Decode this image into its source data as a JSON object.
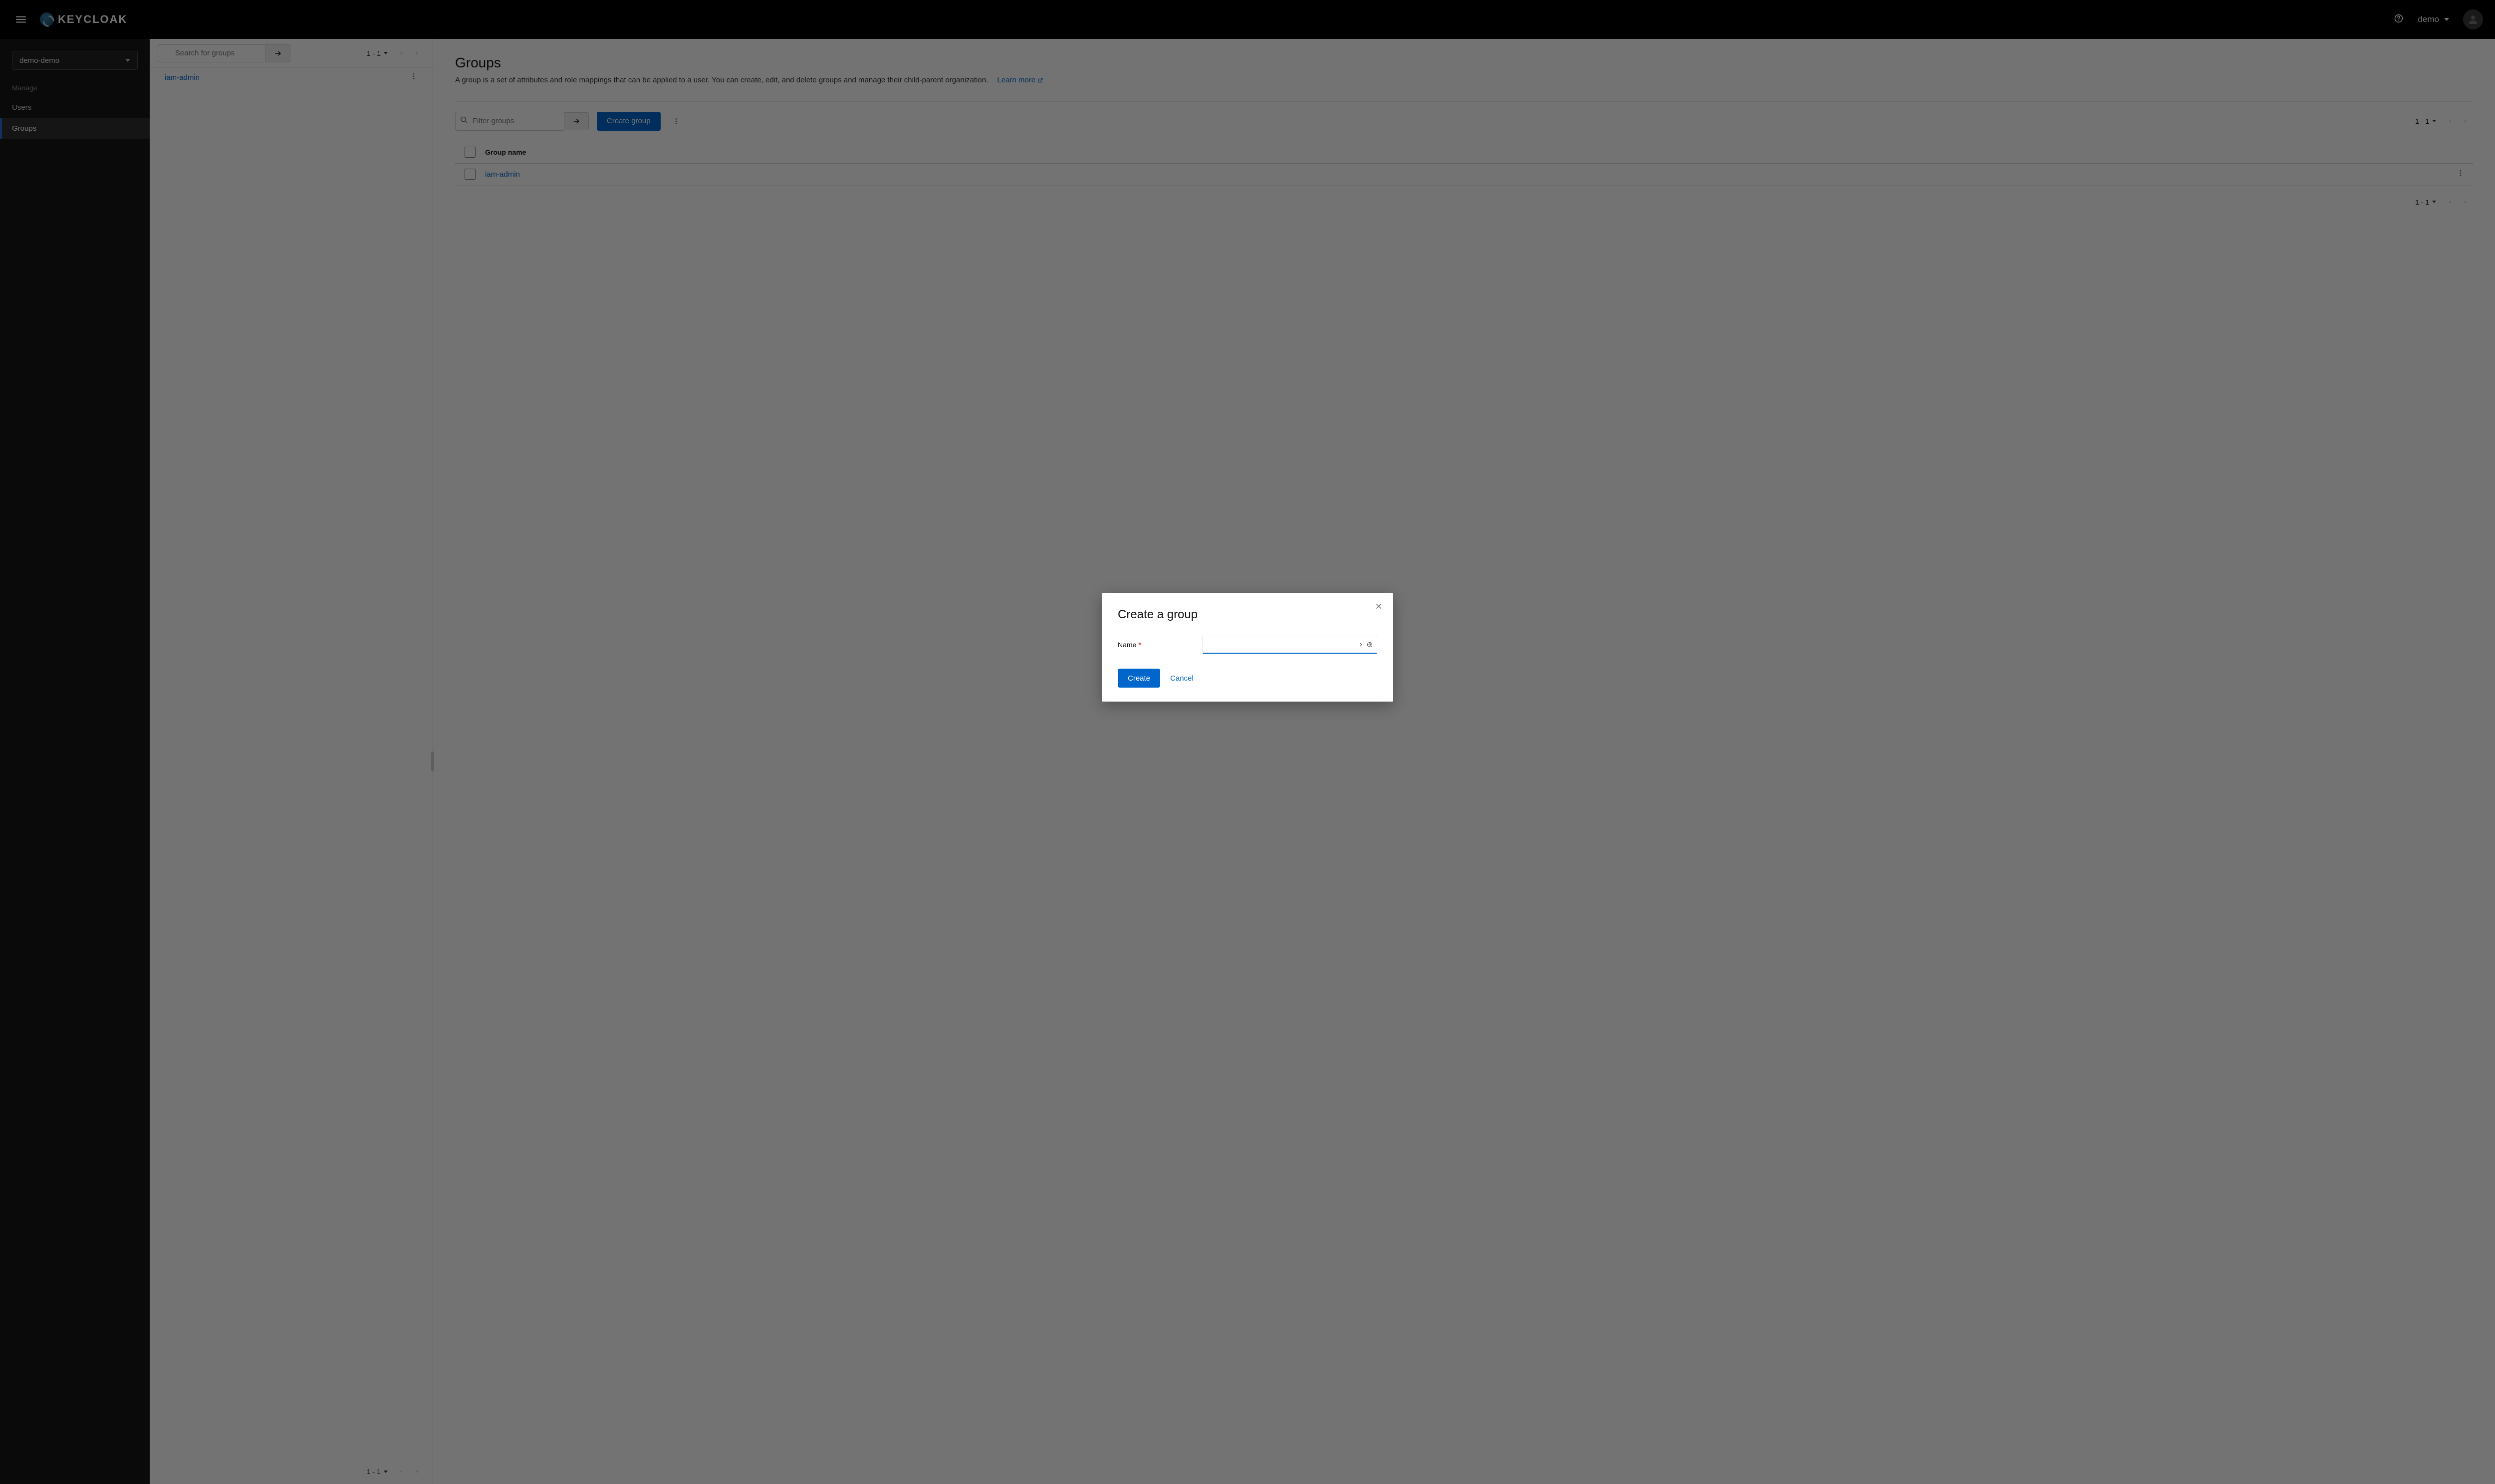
{
  "header": {
    "logo_text": "KEYCLOAK",
    "user": "demo"
  },
  "sidebar": {
    "realm_selected": "demo-demo",
    "section_title": "Manage",
    "items": [
      {
        "label": "Users",
        "active": false
      },
      {
        "label": "Groups",
        "active": true
      }
    ]
  },
  "panel": {
    "search_placeholder": "Search for groups",
    "pagination_top": "1 - 1",
    "pagination_bottom": "1 - 1",
    "rows": [
      {
        "name": "iam-admin"
      }
    ]
  },
  "main": {
    "title": "Groups",
    "description": "A group is a set of attributes and role mappings that can be applied to a user. You can create, edit, and delete groups and manage their child-parent organization.",
    "learn_more": "Learn more",
    "filter_placeholder": "Filter groups",
    "create_button": "Create group",
    "pagination_top": "1 - 1",
    "pagination_bottom": "1 - 1",
    "table": {
      "header": "Group name",
      "rows": [
        {
          "name": "iam-admin"
        }
      ]
    }
  },
  "modal": {
    "title": "Create a group",
    "name_label": "Name",
    "name_required": "*",
    "name_value": "",
    "create": "Create",
    "cancel": "Cancel"
  }
}
